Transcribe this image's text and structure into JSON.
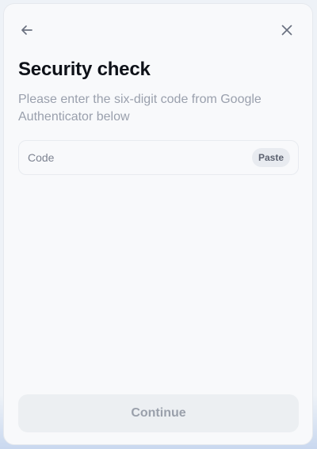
{
  "header": {
    "back_icon": "arrow-left-icon",
    "close_icon": "close-icon"
  },
  "content": {
    "title": "Security check",
    "subtitle": "Please enter the six-digit code from Google Authenticator below"
  },
  "code_field": {
    "value": "",
    "placeholder": "Code",
    "paste_label": "Paste"
  },
  "footer": {
    "continue_label": "Continue"
  },
  "colors": {
    "text_primary": "#0e1118",
    "text_muted": "#9aa0ad",
    "surface": "#f8f9fb",
    "disabled_button": "#eceff2"
  }
}
